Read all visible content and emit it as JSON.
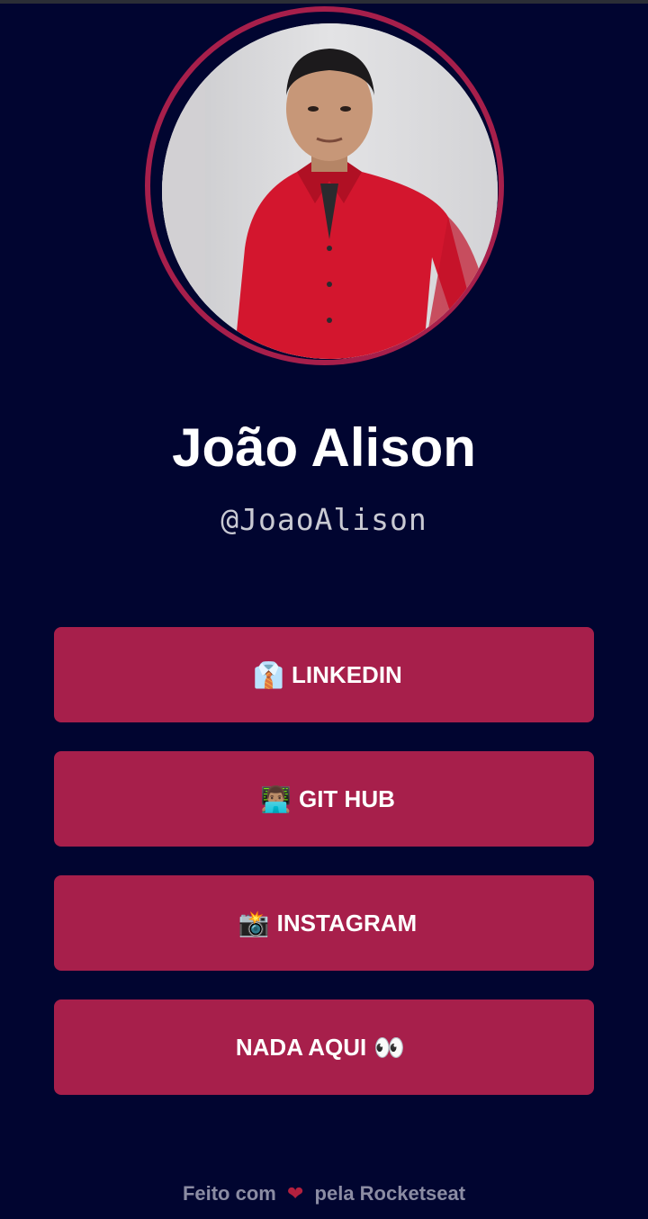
{
  "profile": {
    "name": "João Alison",
    "handle": "@JoaoAlison"
  },
  "links": [
    {
      "label": "LINKEDIN",
      "icon": "👔",
      "icon_name": "necktie-shirt-icon"
    },
    {
      "label": "GIT HUB",
      "icon": "👨🏽‍💻",
      "icon_name": "technologist-icon"
    },
    {
      "label": "INSTAGRAM",
      "icon": "📸",
      "icon_name": "camera-flash-icon"
    },
    {
      "label": "NADA AQUI",
      "icon": "👀",
      "icon_name": "eyes-icon"
    }
  ],
  "footer": {
    "prefix": "Feito com",
    "heart": "❤",
    "suffix": "pela Rocketseat"
  },
  "colors": {
    "background": "#010530",
    "accent": "#a71f4b",
    "text": "#ffffff",
    "muted": "#8b8ca3"
  }
}
